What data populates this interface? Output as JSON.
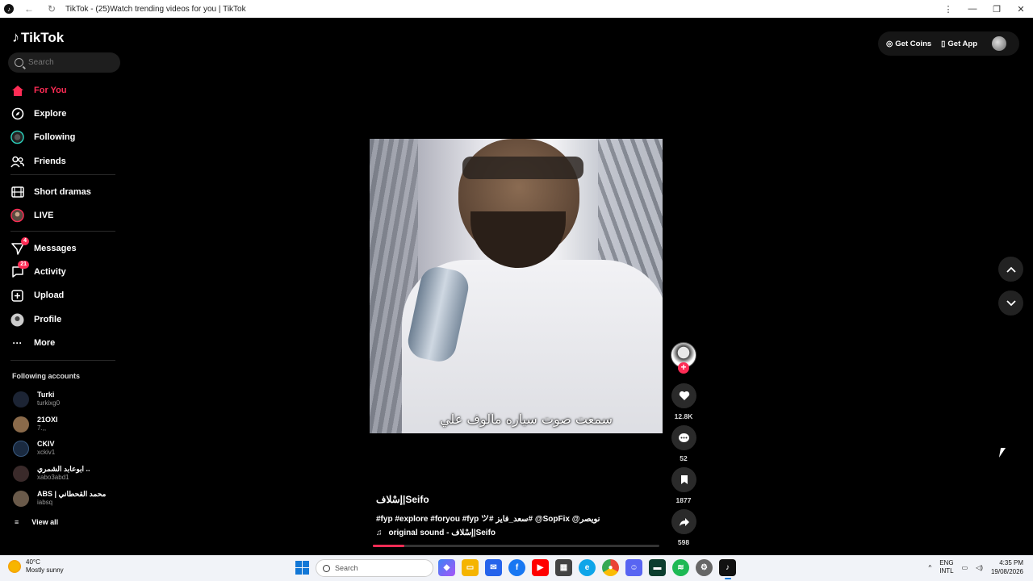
{
  "window": {
    "title": "TikTok - (25)Watch trending videos for you | TikTok"
  },
  "sidebar": {
    "logo": "TikTok",
    "search_placeholder": "Search",
    "nav": [
      {
        "label": "For You",
        "icon": "home-icon"
      },
      {
        "label": "Explore",
        "icon": "compass-icon"
      },
      {
        "label": "Following",
        "icon": "following-icon"
      },
      {
        "label": "Friends",
        "icon": "friends-icon"
      },
      {
        "label": "Short dramas",
        "icon": "film-icon"
      },
      {
        "label": "LIVE",
        "icon": "live-icon"
      },
      {
        "label": "Messages",
        "icon": "send-icon",
        "badge": "4"
      },
      {
        "label": "Activity",
        "icon": "activity-icon",
        "badge": "21"
      },
      {
        "label": "Upload",
        "icon": "plus-square-icon"
      },
      {
        "label": "Profile",
        "icon": "profile-icon"
      },
      {
        "label": "More",
        "icon": "more-icon"
      }
    ],
    "following_title": "Following accounts",
    "accounts": [
      {
        "name": "Turki",
        "handle": "turkixg0"
      },
      {
        "name": "21OXI",
        "handle": "7.,,"
      },
      {
        "name": "CKIV",
        "handle": "xckiv1"
      },
      {
        "name": "ابوعابد الشمري ..",
        "handle": "xabo3abd1"
      },
      {
        "name": "ABS | محمد القحطاني",
        "handle": "iabsq"
      }
    ],
    "view_all": "View all"
  },
  "topbar": {
    "get_coins": "Get Coins",
    "get_app": "Get App"
  },
  "video": {
    "caption_overlay": "سمعت صوت سياره مالوف علي",
    "author": "إسْلاف|Seifo",
    "description": "#fyp #explore #foryou #fyp ツ# سعد_فايز# @SopFix @نويصر",
    "sound": "original sound - إسْلاف|Seifo",
    "progress": 0.11
  },
  "actions": {
    "likes": "12.8K",
    "comments": "52",
    "saves": "1877",
    "shares": "598"
  },
  "taskbar": {
    "weather_temp": "40°C",
    "weather_desc": "Mostly sunny",
    "search_placeholder": "Search",
    "lang_1": "ENG",
    "lang_2": "INTL",
    "time": "4:35 PM",
    "date": "19/08/2026"
  }
}
